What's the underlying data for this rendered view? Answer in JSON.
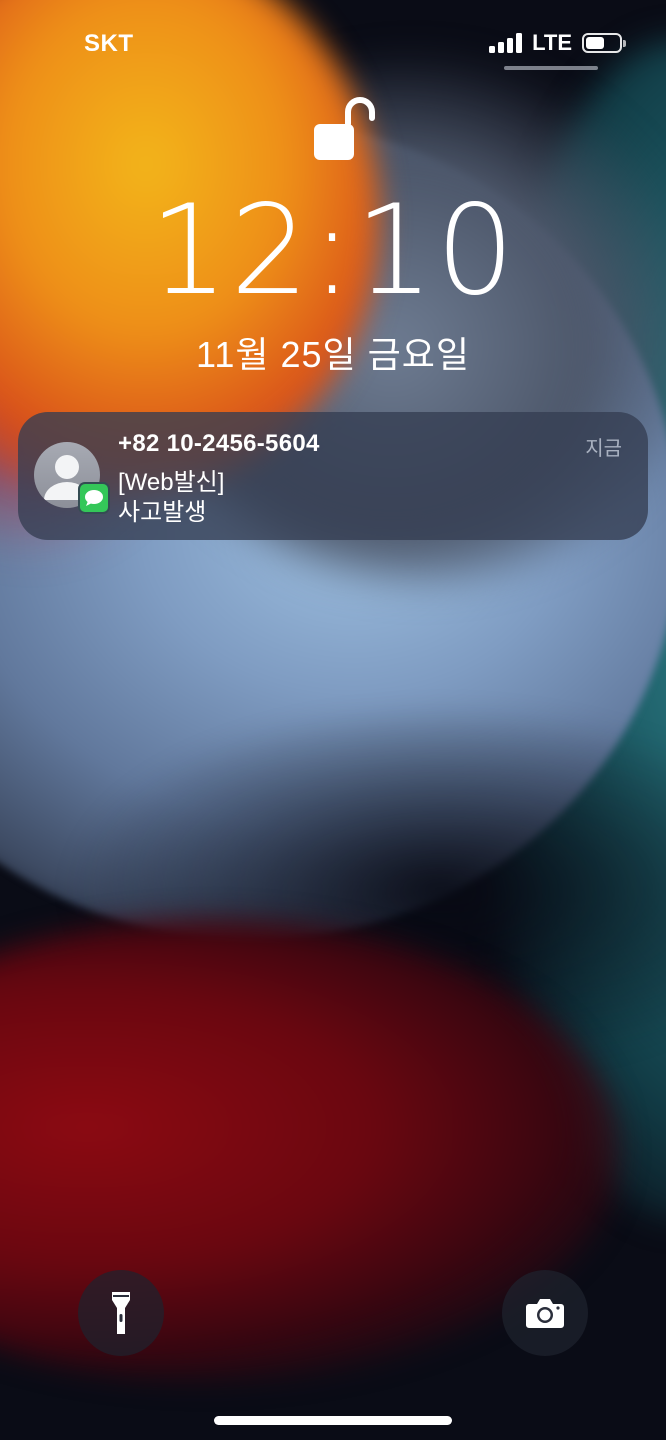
{
  "status_bar": {
    "carrier": "SKT",
    "network": "LTE",
    "battery_level": 0.55,
    "signal_bars_active": 4
  },
  "lock_screen": {
    "time": "12:10",
    "date": "11월 25일 금요일",
    "lock_state": "unlocked"
  },
  "notification": {
    "sender": "+82 10-2456-5604",
    "time": "지금",
    "line1": "[Web발신]",
    "line2": "사고발생",
    "app_icon": "messages-icon",
    "badge_color": "#34c759"
  },
  "quick_actions": {
    "left_icon": "flashlight-icon",
    "right_icon": "camera-icon"
  }
}
